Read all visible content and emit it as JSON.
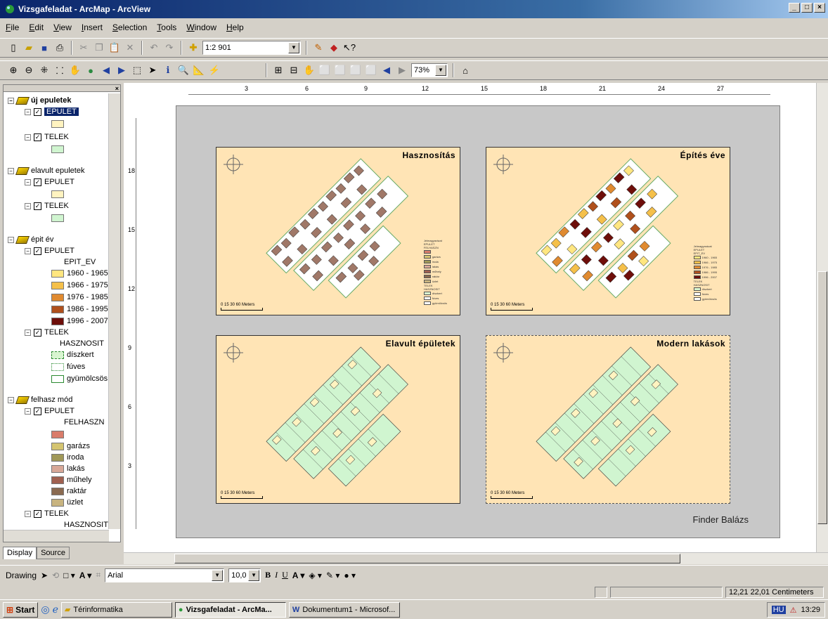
{
  "window": {
    "title": "Vizsgafeladat - ArcMap - ArcView",
    "controls": [
      "_",
      "□",
      "×"
    ]
  },
  "menu": [
    "File",
    "Edit",
    "View",
    "Insert",
    "Selection",
    "Tools",
    "Window",
    "Help"
  ],
  "toolbar1": {
    "scale": "1:2 901"
  },
  "toolbar2": {
    "zoom": "73%"
  },
  "toc": {
    "groups": [
      {
        "name": "új epuletek",
        "selected_layer": "EPULET",
        "layers": [
          {
            "name": "EPULET",
            "checked": true,
            "color": "#fff3c0"
          },
          {
            "name": "TELEK",
            "checked": true,
            "color": "#d0f5d0"
          }
        ]
      },
      {
        "name": "elavult epuletek",
        "layers": [
          {
            "name": "EPULET",
            "checked": true,
            "color": "#fff3c0"
          },
          {
            "name": "TELEK",
            "checked": true,
            "color": "#d0f5d0"
          }
        ]
      },
      {
        "name": "épit év",
        "layers": [
          {
            "name": "EPULET",
            "field": "EPIT_EV",
            "classes": [
              {
                "label": "1960 - 1965",
                "color": "#ffe680"
              },
              {
                "label": "1966 - 1975",
                "color": "#f5c04a"
              },
              {
                "label": "1976 - 1985",
                "color": "#e08a30"
              },
              {
                "name": "",
                "label": "1986 - 1995",
                "color": "#b0501c"
              },
              {
                "label": "1996 - 2007",
                "color": "#6e0e0a"
              }
            ]
          },
          {
            "name": "TELEK",
            "field": "HASZNOSIT",
            "classes": [
              {
                "label": "díszkert",
                "color": "#d8f5d0"
              },
              {
                "label": "fúves",
                "color": "#ffffff"
              },
              {
                "label": "gyümölcsös",
                "color": "#ffffff"
              }
            ]
          }
        ]
      },
      {
        "name": "felhasz mód",
        "layers": [
          {
            "name": "EPULET",
            "field": "FELHASZN",
            "classes": [
              {
                "label": "",
                "color": "#d97c6a"
              },
              {
                "label": "garázs",
                "color": "#d4c470"
              },
              {
                "label": "iroda",
                "color": "#a09858"
              },
              {
                "label": "lakás",
                "color": "#d8a898"
              },
              {
                "label": "műhely",
                "color": "#a06050"
              },
              {
                "label": "raktár",
                "color": "#8a6a50"
              },
              {
                "label": "üzlet",
                "color": "#c8b480"
              }
            ]
          },
          {
            "name": "TELEK",
            "field": "HASZNOSIT"
          }
        ]
      }
    ],
    "tabs": [
      "Display",
      "Source"
    ]
  },
  "ruler": {
    "h": [
      "3",
      "6",
      "9",
      "12",
      "15",
      "18",
      "21",
      "24",
      "27"
    ],
    "v": [
      "18",
      "15",
      "12",
      "9",
      "6",
      "3"
    ]
  },
  "layout": {
    "maps": [
      {
        "title": "Hasznosítás",
        "scale_labels": "0   15  30       60  Meters",
        "legend": [
          "Jelmagyarázat",
          "EPULET",
          "FELHASZN",
          "",
          "garázs",
          "iroda",
          "lakás",
          "műhely",
          "raktár",
          "üzlet",
          "TELEK",
          "HASZNOSIT",
          "díszkert",
          "fúves",
          "gyümölcsös"
        ]
      },
      {
        "title": "Építés éve",
        "scale_labels": "0   15  30       60  Meters",
        "legend": [
          "Jelmagyarázat",
          "EPULET",
          "EPIT_EV",
          "1960 - 1965",
          "1966 - 1975",
          "1976 - 1985",
          "1986 - 1995",
          "1996 - 2007",
          "TELEK",
          "HASZNOSIT",
          "díszkert",
          "fúves",
          "gyümölcsös"
        ]
      },
      {
        "title": "Elavult épületek",
        "scale_labels": "0   15  30       60  Meters"
      },
      {
        "title": "Modern lakások",
        "scale_labels": "0   15  30       60  Meters"
      }
    ],
    "author": "Finder Balázs"
  },
  "drawing": {
    "label": "Drawing",
    "font": "Arial",
    "size": "10,0",
    "bold": "B",
    "italic": "I",
    "underline": "U"
  },
  "status": {
    "coords": "12,21  22,01 Centimeters"
  },
  "taskbar": {
    "start": "Start",
    "tasks": [
      "Térinformatika",
      "Vizsgafeladat - ArcMa...",
      "Dokumentum1 - Microsof..."
    ],
    "lang": "HU",
    "time": "13:29"
  }
}
